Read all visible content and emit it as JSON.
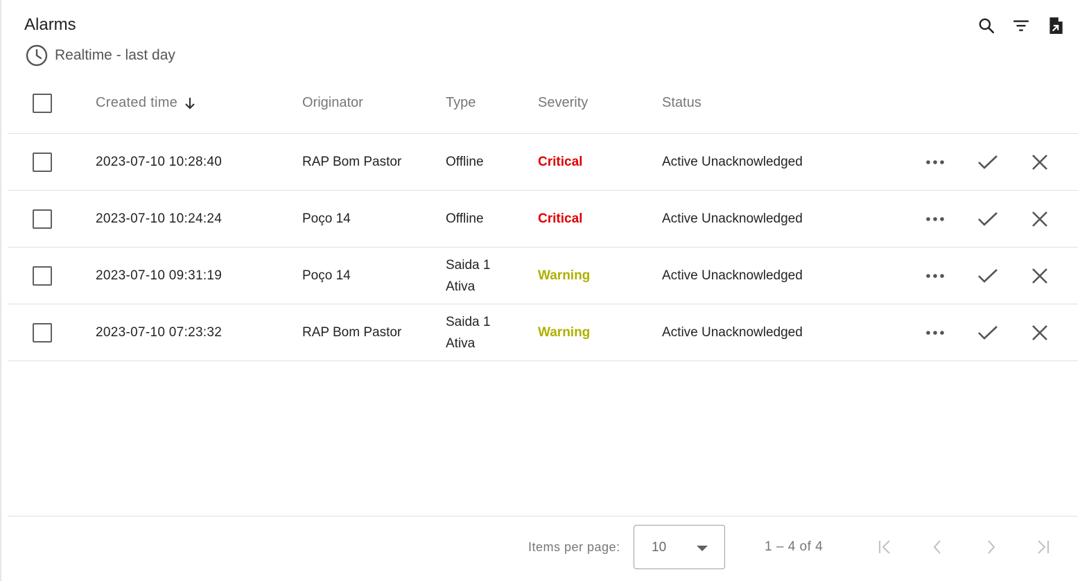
{
  "header": {
    "title": "Alarms",
    "timewindow_label": "Realtime - last day"
  },
  "toolbar": {
    "icons": [
      "search-icon",
      "filter-icon",
      "export-file-icon"
    ]
  },
  "table": {
    "columns": {
      "created_time": "Created time",
      "originator": "Originator",
      "type": "Type",
      "severity": "Severity",
      "status": "Status"
    },
    "sort": {
      "column": "created_time",
      "direction": "descending"
    },
    "rows": [
      {
        "created_time": "2023-07-10 10:28:40",
        "originator": "RAP Bom Pastor",
        "type": "Offline",
        "severity": "Critical",
        "status": "Active Unacknowledged"
      },
      {
        "created_time": "2023-07-10 10:24:24",
        "originator": "Poço 14",
        "type": "Offline",
        "severity": "Critical",
        "status": "Active Unacknowledged"
      },
      {
        "created_time": "2023-07-10 09:31:19",
        "originator": "Poço 14",
        "type": "Saida 1 Ativa",
        "severity": "Warning",
        "status": "Active Unacknowledged"
      },
      {
        "created_time": "2023-07-10 07:23:32",
        "originator": "RAP Bom Pastor",
        "type": "Saida 1 Ativa",
        "severity": "Warning",
        "status": "Active Unacknowledged"
      }
    ]
  },
  "severity_colors": {
    "Critical": "#e00000",
    "Warning": "#b0b000"
  },
  "paginator": {
    "items_per_page_label": "Items per page:",
    "page_size": "10",
    "range_label": "1 – 4 of 4"
  }
}
